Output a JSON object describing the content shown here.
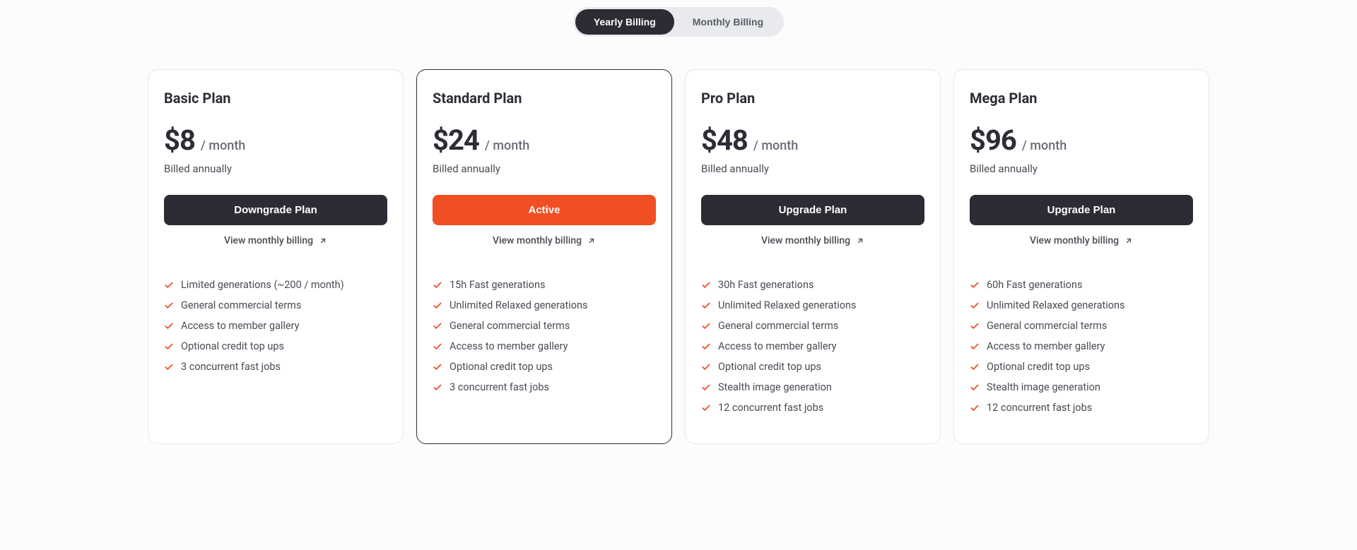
{
  "billing_toggle": {
    "yearly_label": "Yearly Billing",
    "monthly_label": "Monthly Billing",
    "active": "yearly"
  },
  "view_link_label": "View monthly billing",
  "plans": [
    {
      "name": "Basic Plan",
      "price": "$8",
      "period": "/ month",
      "note": "Billed annually",
      "cta_label": "Downgrade Plan",
      "cta_style": "dark",
      "current": false,
      "features": [
        "Limited generations (~200 / month)",
        "General commercial terms",
        "Access to member gallery",
        "Optional credit top ups",
        "3 concurrent fast jobs"
      ]
    },
    {
      "name": "Standard Plan",
      "price": "$24",
      "period": "/ month",
      "note": "Billed annually",
      "cta_label": "Active",
      "cta_style": "orange",
      "current": true,
      "features": [
        "15h Fast generations",
        "Unlimited Relaxed generations",
        "General commercial terms",
        "Access to member gallery",
        "Optional credit top ups",
        "3 concurrent fast jobs"
      ]
    },
    {
      "name": "Pro Plan",
      "price": "$48",
      "period": "/ month",
      "note": "Billed annually",
      "cta_label": "Upgrade Plan",
      "cta_style": "dark",
      "current": false,
      "features": [
        "30h Fast generations",
        "Unlimited Relaxed generations",
        "General commercial terms",
        "Access to member gallery",
        "Optional credit top ups",
        "Stealth image generation",
        "12 concurrent fast jobs"
      ]
    },
    {
      "name": "Mega Plan",
      "price": "$96",
      "period": "/ month",
      "note": "Billed annually",
      "cta_label": "Upgrade Plan",
      "cta_style": "dark",
      "current": false,
      "features": [
        "60h Fast generations",
        "Unlimited Relaxed generations",
        "General commercial terms",
        "Access to member gallery",
        "Optional credit top ups",
        "Stealth image generation",
        "12 concurrent fast jobs"
      ]
    }
  ]
}
